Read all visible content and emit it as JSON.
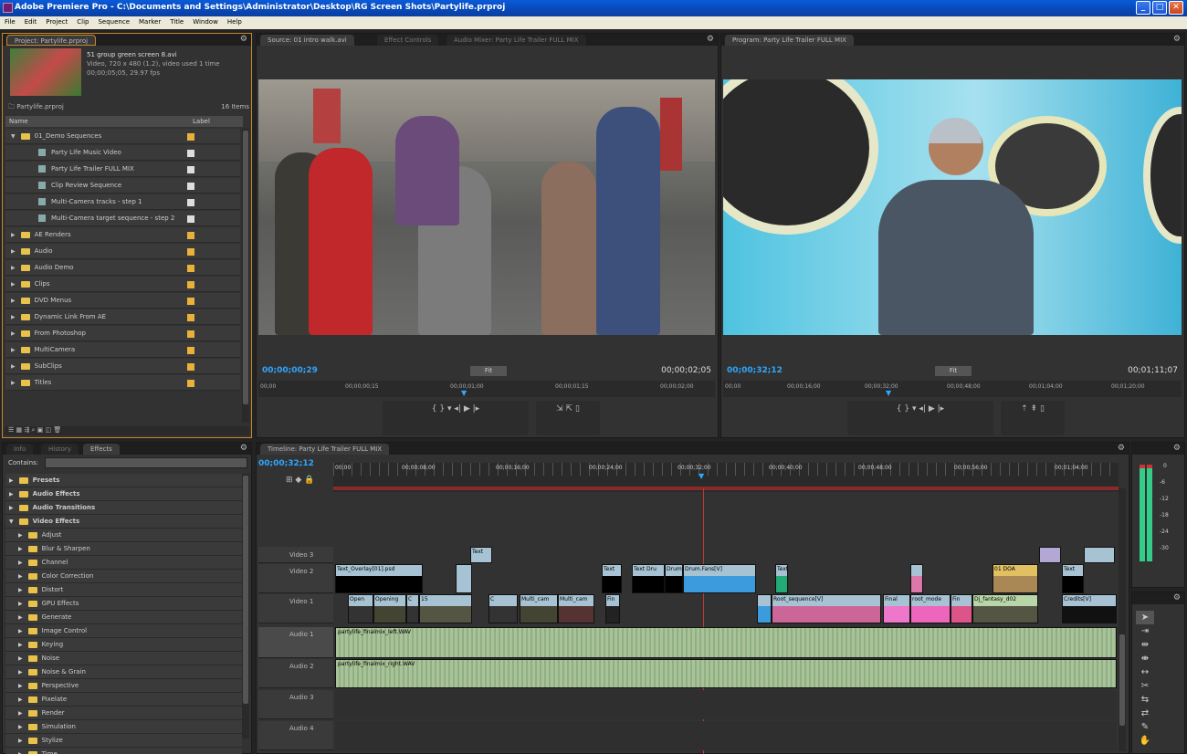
{
  "window": {
    "title": "Adobe Premiere Pro - C:\\Documents and Settings\\Administrator\\Desktop\\RG Screen Shots\\Partylife.prproj",
    "min": "_",
    "max": "□",
    "close": "✕"
  },
  "menu": [
    "File",
    "Edit",
    "Project",
    "Clip",
    "Sequence",
    "Marker",
    "Title",
    "Window",
    "Help"
  ],
  "project": {
    "tab": "Project: Partylife.prproj",
    "clip_name": "51 group green screen 8.avi",
    "clip_info1": "Video, 720 x 480 (1.2)",
    "clip_info2": "00;00;05;05, 29.97 fps",
    "clip_info3": ", video used 1 time",
    "bin_name": "Partylife.prproj",
    "items_count": "16 Items",
    "col_name": "Name",
    "col_label": "Label",
    "rows": [
      {
        "name": "01_Demo Sequences",
        "type": "folder",
        "open": true
      },
      {
        "name": "Party Life Music Video",
        "type": "seq"
      },
      {
        "name": "Party Life Trailer FULL MIX",
        "type": "seq"
      },
      {
        "name": "Clip Review Sequence",
        "type": "seq"
      },
      {
        "name": "Multi-Camera tracks - step 1",
        "type": "seq"
      },
      {
        "name": "Multi-Camera target sequence - step 2",
        "type": "seq"
      },
      {
        "name": "AE Renders",
        "type": "folder"
      },
      {
        "name": "Audio",
        "type": "folder"
      },
      {
        "name": "Audio Demo",
        "type": "folder"
      },
      {
        "name": "Clips",
        "type": "folder"
      },
      {
        "name": "DVD Menus",
        "type": "folder"
      },
      {
        "name": "Dynamic Link From AE",
        "type": "folder"
      },
      {
        "name": "From Photoshop",
        "type": "folder"
      },
      {
        "name": "MultiCamera",
        "type": "folder"
      },
      {
        "name": "SubClips",
        "type": "folder"
      },
      {
        "name": "Titles",
        "type": "folder"
      }
    ]
  },
  "source": {
    "tab1": "Source: 01 intro walk.avi",
    "tab2": "Effect Controls",
    "tab3": "Audio Mixer: Party Life Trailer FULL MIX",
    "tc_current": "00;00;00;29",
    "fit": "Fit",
    "tc_duration": "00;00;02;05",
    "ruler": [
      "00;00",
      "00;00;00;15",
      "00;00;01;00",
      "00;00;01;15",
      "00;00;02;00"
    ]
  },
  "program": {
    "tab": "Program: Party Life Trailer FULL MIX",
    "tc_current": "00;00;32;12",
    "fit": "Fit",
    "tc_duration": "00;01;11;07",
    "ruler": [
      "00;00",
      "00;00;16;00",
      "00;00;32;00",
      "00;00;48;00",
      "00;01;04;00",
      "00;01;20;00"
    ]
  },
  "effects": {
    "tab1": "Info",
    "tab2": "History",
    "tab3": "Effects",
    "contains_label": "Contains:",
    "rows": [
      {
        "name": "Presets",
        "level": 0
      },
      {
        "name": "Audio Effects",
        "level": 0
      },
      {
        "name": "Audio Transitions",
        "level": 0
      },
      {
        "name": "Video Effects",
        "level": 0,
        "open": true
      },
      {
        "name": "Adjust",
        "level": 1
      },
      {
        "name": "Blur & Sharpen",
        "level": 1
      },
      {
        "name": "Channel",
        "level": 1
      },
      {
        "name": "Color Correction",
        "level": 1
      },
      {
        "name": "Distort",
        "level": 1
      },
      {
        "name": "GPU Effects",
        "level": 1
      },
      {
        "name": "Generate",
        "level": 1
      },
      {
        "name": "Image Control",
        "level": 1
      },
      {
        "name": "Keying",
        "level": 1
      },
      {
        "name": "Noise",
        "level": 1
      },
      {
        "name": "Noise & Grain",
        "level": 1
      },
      {
        "name": "Perspective",
        "level": 1
      },
      {
        "name": "Pixelate",
        "level": 1
      },
      {
        "name": "Render",
        "level": 1
      },
      {
        "name": "Simulation",
        "level": 1
      },
      {
        "name": "Stylize",
        "level": 1
      },
      {
        "name": "Time",
        "level": 1
      }
    ]
  },
  "timeline": {
    "tab": "Timeline: Party Life Trailer FULL MIX",
    "tc": "00;00;32;12",
    "ruler": [
      "00;00",
      "00;00;08;00",
      "00;00;16;00",
      "00;00;24;00",
      "00;00;32;00",
      "00;00;40;00",
      "00;00;48;00",
      "00;00;56;00",
      "00;01;04;00"
    ],
    "tracks": [
      "Video 3",
      "Video 2",
      "Video 1",
      "Audio 1",
      "Audio 2",
      "Audio 3",
      "Audio 4"
    ],
    "audio1_clip": "partylife_finalmix_left.WAV",
    "audio2_clip": "partylife_finalmix_right.WAV",
    "v2_clips": [
      "Text_Overlay[01].psd",
      "Text",
      "Text Dru",
      "Drum",
      "Drum.Fans[V]",
      "Text[V]",
      "01 DOA",
      "Text"
    ],
    "v1_clips": [
      "Open",
      "Opening",
      "C",
      "15",
      "C",
      "Multi_cam",
      "Multi_cam",
      "Fin",
      "Root_sequence[V]",
      "Final",
      "root_mode",
      "Fin",
      "Dj_fantasy_d02",
      "Credits[V]"
    ],
    "v3_clip": "Text"
  },
  "meter": {
    "top": "0",
    "marks": [
      "-6",
      "-12",
      "-18",
      "-24",
      "-30"
    ]
  },
  "colors": {
    "accent": "#2fa6ff",
    "folder": "#e8c24a",
    "video_clip": "#a7c3d3",
    "audio_clip": "#a9c29a",
    "playhead": "#c0392b"
  }
}
